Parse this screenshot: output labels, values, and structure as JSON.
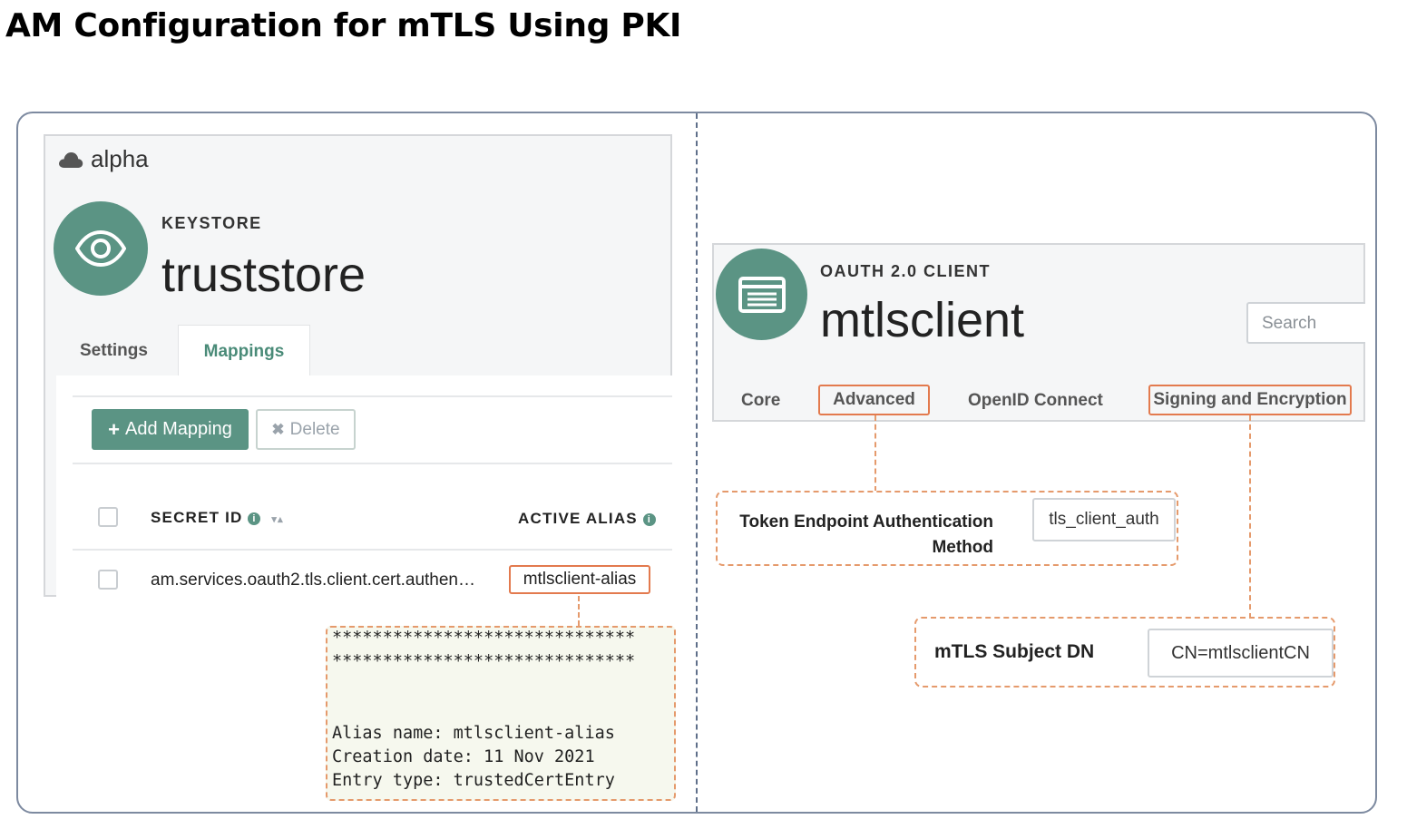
{
  "page": {
    "title": "AM Configuration for mTLS Using PKI"
  },
  "left": {
    "realm": "alpha",
    "type_label": "KEYSTORE",
    "name": "truststore",
    "tabs": [
      {
        "label": "Settings"
      },
      {
        "label": "Mappings"
      }
    ],
    "add_button": "Add Mapping",
    "delete_button": "Delete",
    "table": {
      "headers": [
        "SECRET ID",
        "ACTIVE ALIAS"
      ],
      "rows": [
        {
          "secret_id": "am.services.oauth2.tls.client.cert.authen…",
          "alias": "mtlsclient-alias"
        }
      ]
    },
    "certificate": {
      "lines": [
        "******************************",
        "******************************",
        "Alias name: mtlsclient-alias",
        "Creation date: 11 Nov 2021",
        "Entry type: trustedCertEntry"
      ]
    }
  },
  "right": {
    "type_label": "OAUTH 2.0 CLIENT",
    "name": "mtlsclient",
    "search_placeholder": "Search",
    "tabs": [
      {
        "label": "Core"
      },
      {
        "label": "Advanced"
      },
      {
        "label": "OpenID Connect"
      },
      {
        "label": "Signing and Encryption"
      }
    ],
    "token_endpoint_auth": {
      "label_line1": "Token Endpoint Authentication",
      "label_line2": "Method",
      "value": "tls_client_auth"
    },
    "mtls_subject_dn": {
      "label": "mTLS Subject DN",
      "value": "CN=mtlsclientCN"
    }
  },
  "colors": {
    "accent": "#5b9484",
    "highlight": "#e37a4e",
    "frame": "#7d8aa0"
  },
  "icons": {
    "realm": "cloud-icon",
    "keystore": "eye-icon",
    "oauth_client": "list-window-icon"
  }
}
